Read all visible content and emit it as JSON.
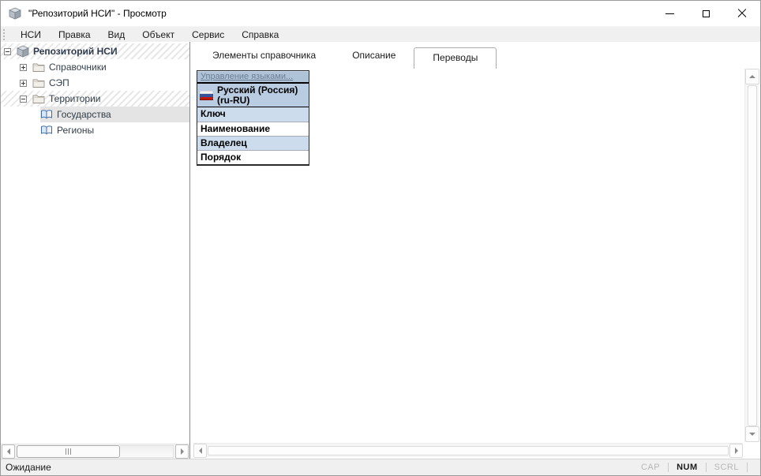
{
  "window": {
    "title": "\"Репозиторий НСИ\" - Просмотр"
  },
  "menu": {
    "items": [
      {
        "label": "НСИ"
      },
      {
        "label": "Правка"
      },
      {
        "label": "Вид"
      },
      {
        "label": "Объект"
      },
      {
        "label": "Сервис"
      },
      {
        "label": "Справка"
      }
    ]
  },
  "tree": {
    "items": [
      {
        "label": "Репозиторий НСИ",
        "level": 0,
        "icon": "repository-package-icon",
        "expander": "minus",
        "hatched": true,
        "bold": true
      },
      {
        "label": "Справочники",
        "level": 1,
        "icon": "folder-icon",
        "expander": "plus"
      },
      {
        "label": "СЭП",
        "level": 1,
        "icon": "folder-icon",
        "expander": "plus"
      },
      {
        "label": "Территории",
        "level": 1,
        "icon": "folder-icon",
        "expander": "minus",
        "hatched": true
      },
      {
        "label": "Государства",
        "level": 2,
        "icon": "open-book-icon",
        "selected": true
      },
      {
        "label": "Регионы",
        "level": 2,
        "icon": "open-book-icon"
      }
    ]
  },
  "tabs": {
    "items": [
      {
        "label": "Элементы справочника",
        "active": false
      },
      {
        "label": "Описание",
        "active": false
      },
      {
        "label": "Переводы",
        "active": true
      }
    ]
  },
  "translations": {
    "manage_link": "Управление языками...",
    "language": {
      "name": "Русский (Россия)",
      "code": "(ru-RU)",
      "flag": "russia-flag-icon"
    },
    "rows": [
      {
        "label": "Ключ"
      },
      {
        "label": "Наименование"
      },
      {
        "label": "Владелец"
      },
      {
        "label": "Порядок"
      }
    ]
  },
  "statusbar": {
    "status": "Ожидание",
    "indicators": [
      {
        "label": "CAP",
        "enabled": false
      },
      {
        "label": "NUM",
        "enabled": true
      },
      {
        "label": "SCRL",
        "enabled": false
      }
    ]
  },
  "colors": {
    "table_header_bg": "#aec3d8",
    "table_lang_row_bg": "#b9cce2",
    "table_alt_row_bg": "#ccdcec",
    "link_text": "#6c7e91",
    "menubar_bg": "#f0f0f0",
    "selected_tree_row_bg": "#e4e4e4",
    "flag_white": "#f2f2f2",
    "flag_blue": "#38539c",
    "flag_red": "#c21807"
  }
}
